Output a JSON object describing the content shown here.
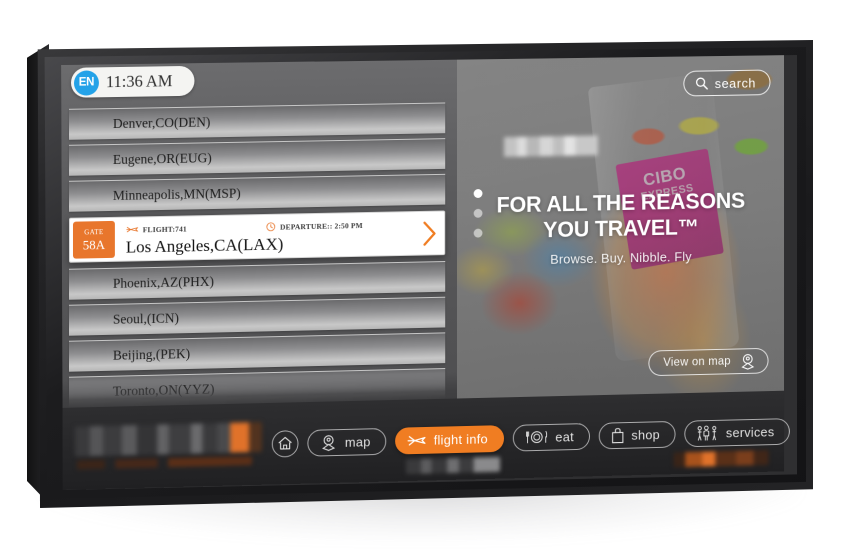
{
  "device": {
    "kind": "wall-mounted-touchscreen-kiosk"
  },
  "status_bar": {
    "language_code": "EN",
    "time": "11:36 AM"
  },
  "flight_list": {
    "rows": [
      {
        "destination": "Denver,CO(DEN)",
        "selected": false
      },
      {
        "destination": "Eugene,OR(EUG)",
        "selected": false
      },
      {
        "destination": "Minneapolis,MN(MSP)",
        "selected": false
      }
    ],
    "selected_row": {
      "gate_label": "GATE",
      "gate_value": "58A",
      "flight_icon": "airplane-icon",
      "flight_text": "FLIGHT:741",
      "clock_icon": "clock-icon",
      "departure_text": "DEPARTURE:: 2:50 PM",
      "destination": "Los Angeles,CA(LAX)",
      "chevron_icon": "chevron-right-icon"
    },
    "rows_after": [
      {
        "destination": "Phoenix,AZ(PHX)",
        "selected": false
      },
      {
        "destination": "Seoul,(ICN)",
        "selected": false
      },
      {
        "destination": "Beijing,(PEK)",
        "selected": false
      },
      {
        "destination": "Toronto,ON(YYZ)",
        "selected": false
      }
    ]
  },
  "ad_panel": {
    "search": {
      "icon": "search-icon",
      "label": "search"
    },
    "brand_logo": "blurred-brand-logo",
    "product_label": {
      "line1": "CIBO",
      "line2": "EXPRESS"
    },
    "carousel": {
      "dots": 3,
      "active_index": 0
    },
    "headline_line1": "FOR ALL THE REASONS",
    "headline_line2": "YOU TRAVEL™",
    "tagline": "Browse. Buy. Nibble. Fly",
    "view_on_map": {
      "label": "View on map",
      "icon": "map-pin-icon"
    }
  },
  "nav_bar": {
    "brand_area": "blurred-brand-mark",
    "items": [
      {
        "id": "home",
        "label": "",
        "icon": "home-icon",
        "active": false,
        "icon_only": true
      },
      {
        "id": "map",
        "label": "map",
        "icon": "map-pin-icon",
        "active": false,
        "icon_only": false
      },
      {
        "id": "flight-info",
        "label": "flight info",
        "icon": "airplane-icon",
        "active": true,
        "icon_only": false
      },
      {
        "id": "eat",
        "label": "eat",
        "icon": "cutlery-icon",
        "active": false,
        "icon_only": false
      },
      {
        "id": "shop",
        "label": "shop",
        "icon": "shopping-bag-icon",
        "active": false,
        "icon_only": false
      },
      {
        "id": "services",
        "label": "services",
        "icon": "family-icon",
        "active": false,
        "icon_only": false
      }
    ],
    "footer_blur_left": "blurred-text-block",
    "footer_blur_right": "blurred-orange-block"
  },
  "colors": {
    "accent_orange": "#f07d22",
    "gate_orange": "#e8762c",
    "lang_blue": "#23a2e8",
    "magenta_label": "#d81b8c",
    "screen_gray": "#5e5e60",
    "nav_dark": "#2e2e30"
  }
}
